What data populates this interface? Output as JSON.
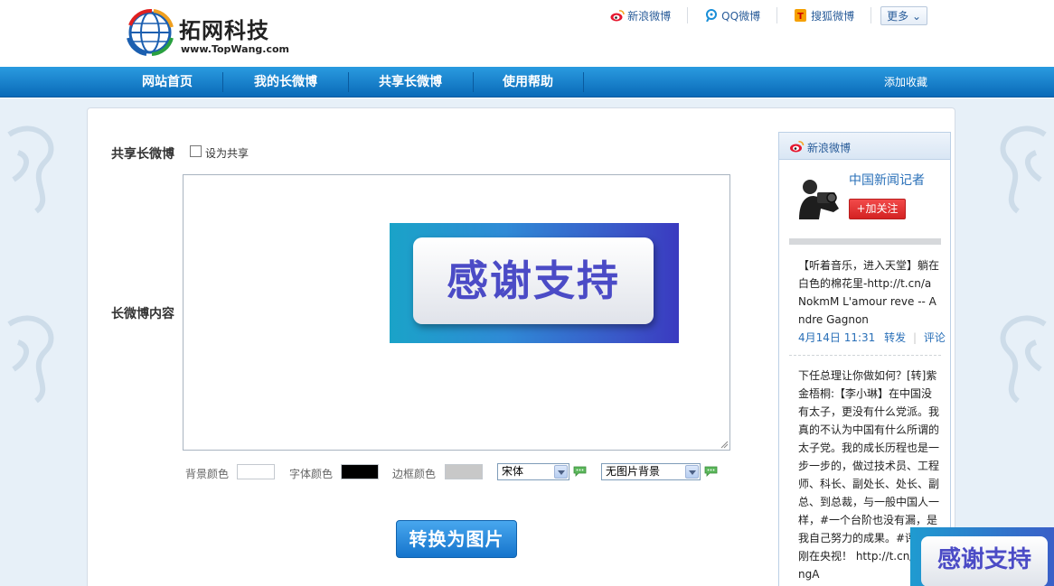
{
  "brand": {
    "name": "拓网科技",
    "url": "www.TopWang.com"
  },
  "top_links": [
    {
      "label": "新浪微博",
      "icon": "sina-weibo-icon"
    },
    {
      "label": "QQ微博",
      "icon": "qq-weibo-icon"
    },
    {
      "label": "搜狐微博",
      "icon": "sohu-weibo-icon"
    }
  ],
  "more_label": "更多",
  "nav": {
    "items": [
      "网站首页",
      "我的长微博",
      "共享长微博",
      "使用帮助"
    ],
    "favorite": "添加收藏"
  },
  "form": {
    "share_label": "共享长微博",
    "share_checkbox_label": "设为共享",
    "share_checked": false,
    "content_label": "长微博内容",
    "banner_text": "感谢支持",
    "bg_color_label": "背景颜色",
    "bg_color": "#ffffff",
    "font_color_label": "字体颜色",
    "font_color": "#000000",
    "border_color_label": "边框颜色",
    "border_color": "#c8c8c8",
    "font_select": "宋体",
    "background_select": "无图片背景",
    "convert_button": "转换为图片"
  },
  "sidebar": {
    "title": "新浪微博",
    "user_name": "中国新闻记者",
    "follow_button": "+加关注",
    "posts": [
      {
        "text": "【听着音乐，进入天堂】躺在白色的棉花里-http://t.cn/aNokmM L'amour reve -- Andre Gagnon",
        "time": "4月14日 11:31",
        "repost": "转发",
        "comment": "评论"
      },
      {
        "text": "下任总理让你做如何？[转]紫金梧桐:【李小琳】在中国没有太子，更没有什么党派。我真的不认为中国有什么所谓的太子党。我的成长历程也是一步一步的，做过技术员、工程师、科长、副处长、处长、副总、到总裁，与一般中国人一样，#一个台阶也没有漏，是我自己努力的成果。#评：李刚在央视！ http://t.cn/h9kngA"
      }
    ]
  },
  "float_ad": {
    "text": "感谢支持"
  },
  "colors": {
    "nav_blue": "#0a6ab8",
    "link_blue": "#2a5d9a",
    "follow_red": "#d42222",
    "button_blue": "#1574cc"
  }
}
